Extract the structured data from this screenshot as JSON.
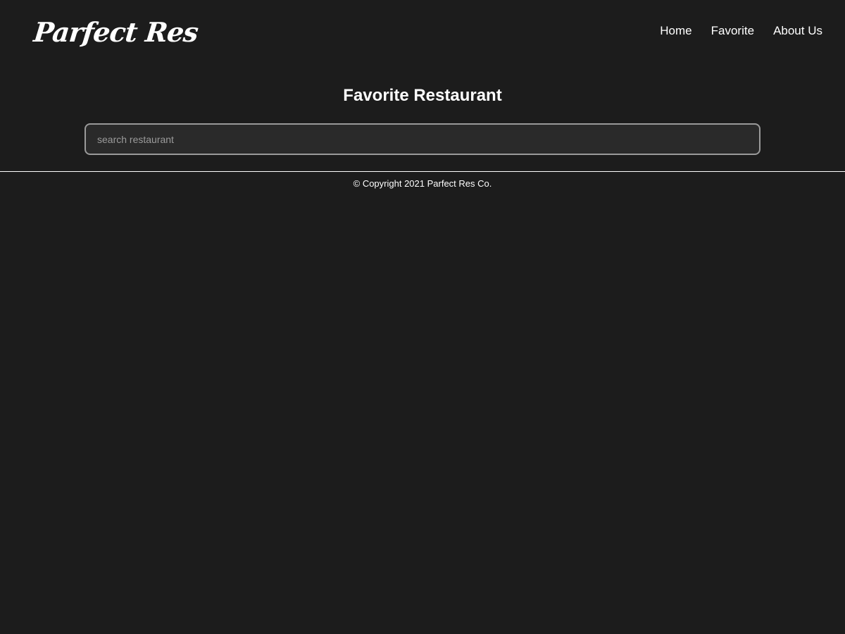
{
  "header": {
    "brand": "Parfect Res",
    "nav": [
      {
        "label": "Home"
      },
      {
        "label": "Favorite"
      },
      {
        "label": "About Us"
      }
    ]
  },
  "main": {
    "title": "Favorite Restaurant",
    "search": {
      "placeholder": "search restaurant",
      "value": ""
    }
  },
  "footer": {
    "copyright": "© Copyright 2021 Parfect Res Co."
  },
  "colors": {
    "background": "#1c1c1c",
    "text": "#ffffff",
    "input_background": "#2a2a2a",
    "input_border": "#9a9a9a",
    "placeholder": "#9b9b9b"
  }
}
